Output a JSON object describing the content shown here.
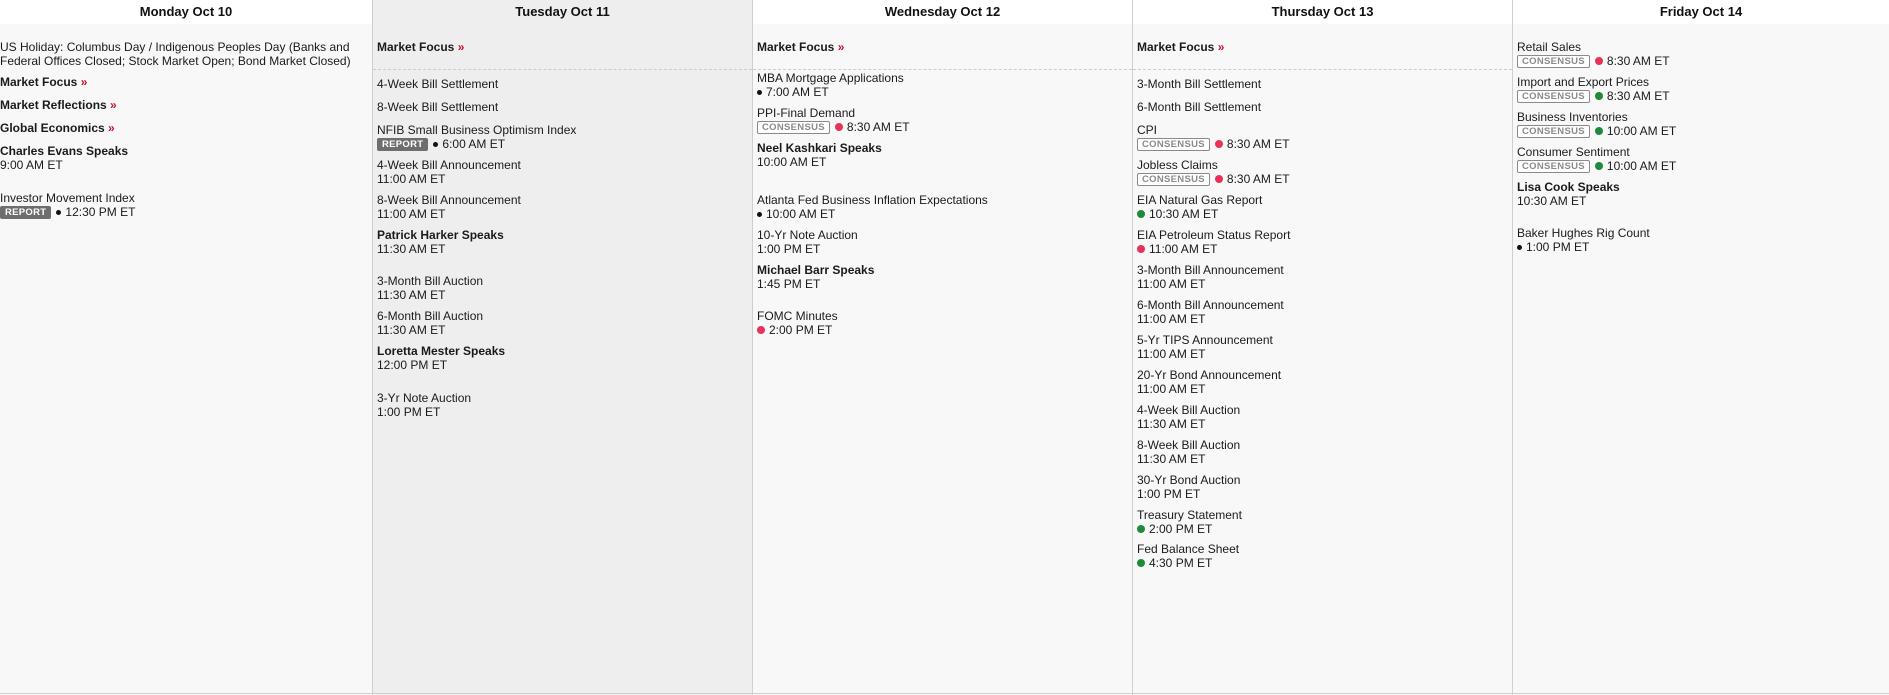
{
  "days": [
    {
      "header": "Monday Oct 10",
      "events": [
        {
          "name": "US Holiday: Columbus Day / Indigenous Peoples Day (Banks and Federal Offices Closed; Stock Market Open; Bond Market Closed)",
          "bold": false,
          "badge": "",
          "dot": "",
          "time": ""
        },
        {
          "name": "Market Focus",
          "bold": true,
          "arrow": "»",
          "badge": "",
          "dot": "",
          "time": ""
        },
        {
          "name": "Market Reflections",
          "bold": true,
          "arrow": "»",
          "badge": "",
          "dot": "",
          "time": ""
        },
        {
          "name": "Global Economics",
          "bold": true,
          "arrow": "»",
          "badge": "",
          "dot": "",
          "time": ""
        },
        {
          "name": "Charles Evans Speaks",
          "bold": true,
          "badge": "",
          "dot": "",
          "time": "9:00 AM ET"
        },
        {
          "name": "Investor Movement Index",
          "bold": false,
          "badge": "REPORT",
          "dot": "black",
          "time": "12:30 PM ET"
        }
      ]
    },
    {
      "header": "Tuesday Oct 11",
      "market_focus": "Market Focus",
      "arrow": "»",
      "events": [
        {
          "name": "4-Week Bill Settlement",
          "bold": false,
          "badge": "",
          "dot": "",
          "time": ""
        },
        {
          "name": "8-Week Bill Settlement",
          "bold": false,
          "badge": "",
          "dot": "",
          "time": ""
        },
        {
          "name": "NFIB Small Business Optimism Index",
          "bold": false,
          "badge": "REPORT",
          "dot": "black",
          "time": "6:00 AM ET"
        },
        {
          "name": "4-Week Bill Announcement",
          "bold": false,
          "badge": "",
          "dot": "",
          "time": "11:00 AM ET"
        },
        {
          "name": "8-Week Bill Announcement",
          "bold": false,
          "badge": "",
          "dot": "",
          "time": "11:00 AM ET"
        },
        {
          "name": "Patrick Harker Speaks",
          "bold": true,
          "badge": "",
          "dot": "",
          "time": "11:30 AM ET"
        },
        {
          "name": "3-Month Bill Auction",
          "bold": false,
          "badge": "",
          "dot": "",
          "time": "11:30 AM ET"
        },
        {
          "name": "6-Month Bill Auction",
          "bold": false,
          "badge": "",
          "dot": "",
          "time": "11:30 AM ET"
        },
        {
          "name": "Loretta Mester Speaks",
          "bold": true,
          "badge": "",
          "dot": "",
          "time": "12:00 PM ET"
        },
        {
          "name": "3-Yr Note Auction",
          "bold": false,
          "badge": "",
          "dot": "",
          "time": "1:00 PM ET"
        }
      ]
    },
    {
      "header": "Wednesday Oct 12",
      "market_focus": "Market Focus",
      "arrow": "»",
      "events": [
        {
          "name": "MBA Mortgage Applications",
          "bold": false,
          "badge": "",
          "dot": "black",
          "time": "7:00 AM ET"
        },
        {
          "name": "PPI-Final Demand",
          "bold": false,
          "badge": "CONSENSUS",
          "dot": "red",
          "time": "8:30 AM ET"
        },
        {
          "name": "Neel Kashkari Speaks",
          "bold": true,
          "badge": "",
          "dot": "",
          "time": "10:00 AM ET"
        },
        {
          "name": "Atlanta Fed Business Inflation Expectations",
          "bold": false,
          "badge": "",
          "dot": "black",
          "time": "10:00 AM ET"
        },
        {
          "name": "10-Yr Note Auction",
          "bold": false,
          "badge": "",
          "dot": "",
          "time": "1:00 PM ET"
        },
        {
          "name": "Michael Barr Speaks",
          "bold": true,
          "badge": "",
          "dot": "",
          "time": "1:45 PM ET"
        },
        {
          "name": "FOMC Minutes",
          "bold": false,
          "badge": "",
          "dot": "red",
          "time": "2:00 PM ET"
        }
      ]
    },
    {
      "header": "Thursday Oct 13",
      "market_focus": "Market Focus",
      "arrow": "»",
      "events": [
        {
          "name": "3-Month Bill Settlement",
          "bold": false,
          "badge": "",
          "dot": "",
          "time": ""
        },
        {
          "name": "6-Month Bill Settlement",
          "bold": false,
          "badge": "",
          "dot": "",
          "time": ""
        },
        {
          "name": "CPI",
          "bold": false,
          "badge": "CONSENSUS",
          "dot": "red",
          "time": "8:30 AM ET"
        },
        {
          "name": "Jobless Claims",
          "bold": false,
          "badge": "CONSENSUS",
          "dot": "red",
          "time": "8:30 AM ET"
        },
        {
          "name": "EIA Natural Gas Report",
          "bold": false,
          "badge": "",
          "dot": "green",
          "time": "10:30 AM ET"
        },
        {
          "name": "EIA Petroleum Status Report",
          "bold": false,
          "badge": "",
          "dot": "red",
          "time": "11:00 AM ET"
        },
        {
          "name": "3-Month Bill Announcement",
          "bold": false,
          "badge": "",
          "dot": "",
          "time": "11:00 AM ET"
        },
        {
          "name": "6-Month Bill Announcement",
          "bold": false,
          "badge": "",
          "dot": "",
          "time": "11:00 AM ET"
        },
        {
          "name": "5-Yr TIPS Announcement",
          "bold": false,
          "badge": "",
          "dot": "",
          "time": "11:00 AM ET"
        },
        {
          "name": "20-Yr Bond Announcement",
          "bold": false,
          "badge": "",
          "dot": "",
          "time": "11:00 AM ET"
        },
        {
          "name": "4-Week Bill Auction",
          "bold": false,
          "badge": "",
          "dot": "",
          "time": "11:30 AM ET"
        },
        {
          "name": "8-Week Bill Auction",
          "bold": false,
          "badge": "",
          "dot": "",
          "time": "11:30 AM ET"
        },
        {
          "name": "30-Yr Bond Auction",
          "bold": false,
          "badge": "",
          "dot": "",
          "time": "1:00 PM ET"
        },
        {
          "name": "Treasury Statement",
          "bold": false,
          "badge": "",
          "dot": "green",
          "time": "2:00 PM ET"
        },
        {
          "name": "Fed Balance Sheet",
          "bold": false,
          "badge": "",
          "dot": "green",
          "time": "4:30 PM ET"
        }
      ]
    },
    {
      "header": "Friday Oct 14",
      "events": [
        {
          "name": "Retail Sales",
          "bold": false,
          "badge": "CONSENSUS",
          "dot": "red",
          "time": "8:30 AM ET"
        },
        {
          "name": "Import and Export Prices",
          "bold": false,
          "badge": "CONSENSUS",
          "dot": "green",
          "time": "8:30 AM ET"
        },
        {
          "name": "Business Inventories",
          "bold": false,
          "badge": "CONSENSUS",
          "dot": "green",
          "time": "10:00 AM ET"
        },
        {
          "name": "Consumer Sentiment",
          "bold": false,
          "badge": "CONSENSUS",
          "dot": "green",
          "time": "10:00 AM ET"
        },
        {
          "name": "Lisa Cook Speaks",
          "bold": true,
          "badge": "",
          "dot": "",
          "time": "10:30 AM ET"
        },
        {
          "name": "Baker Hughes Rig Count",
          "bold": false,
          "badge": "",
          "dot": "black",
          "time": "1:00 PM ET"
        }
      ]
    }
  ],
  "colors": {
    "dot_red": "#e8325a",
    "dot_green": "#1e8a3a",
    "arrow_red": "#c8102e"
  }
}
